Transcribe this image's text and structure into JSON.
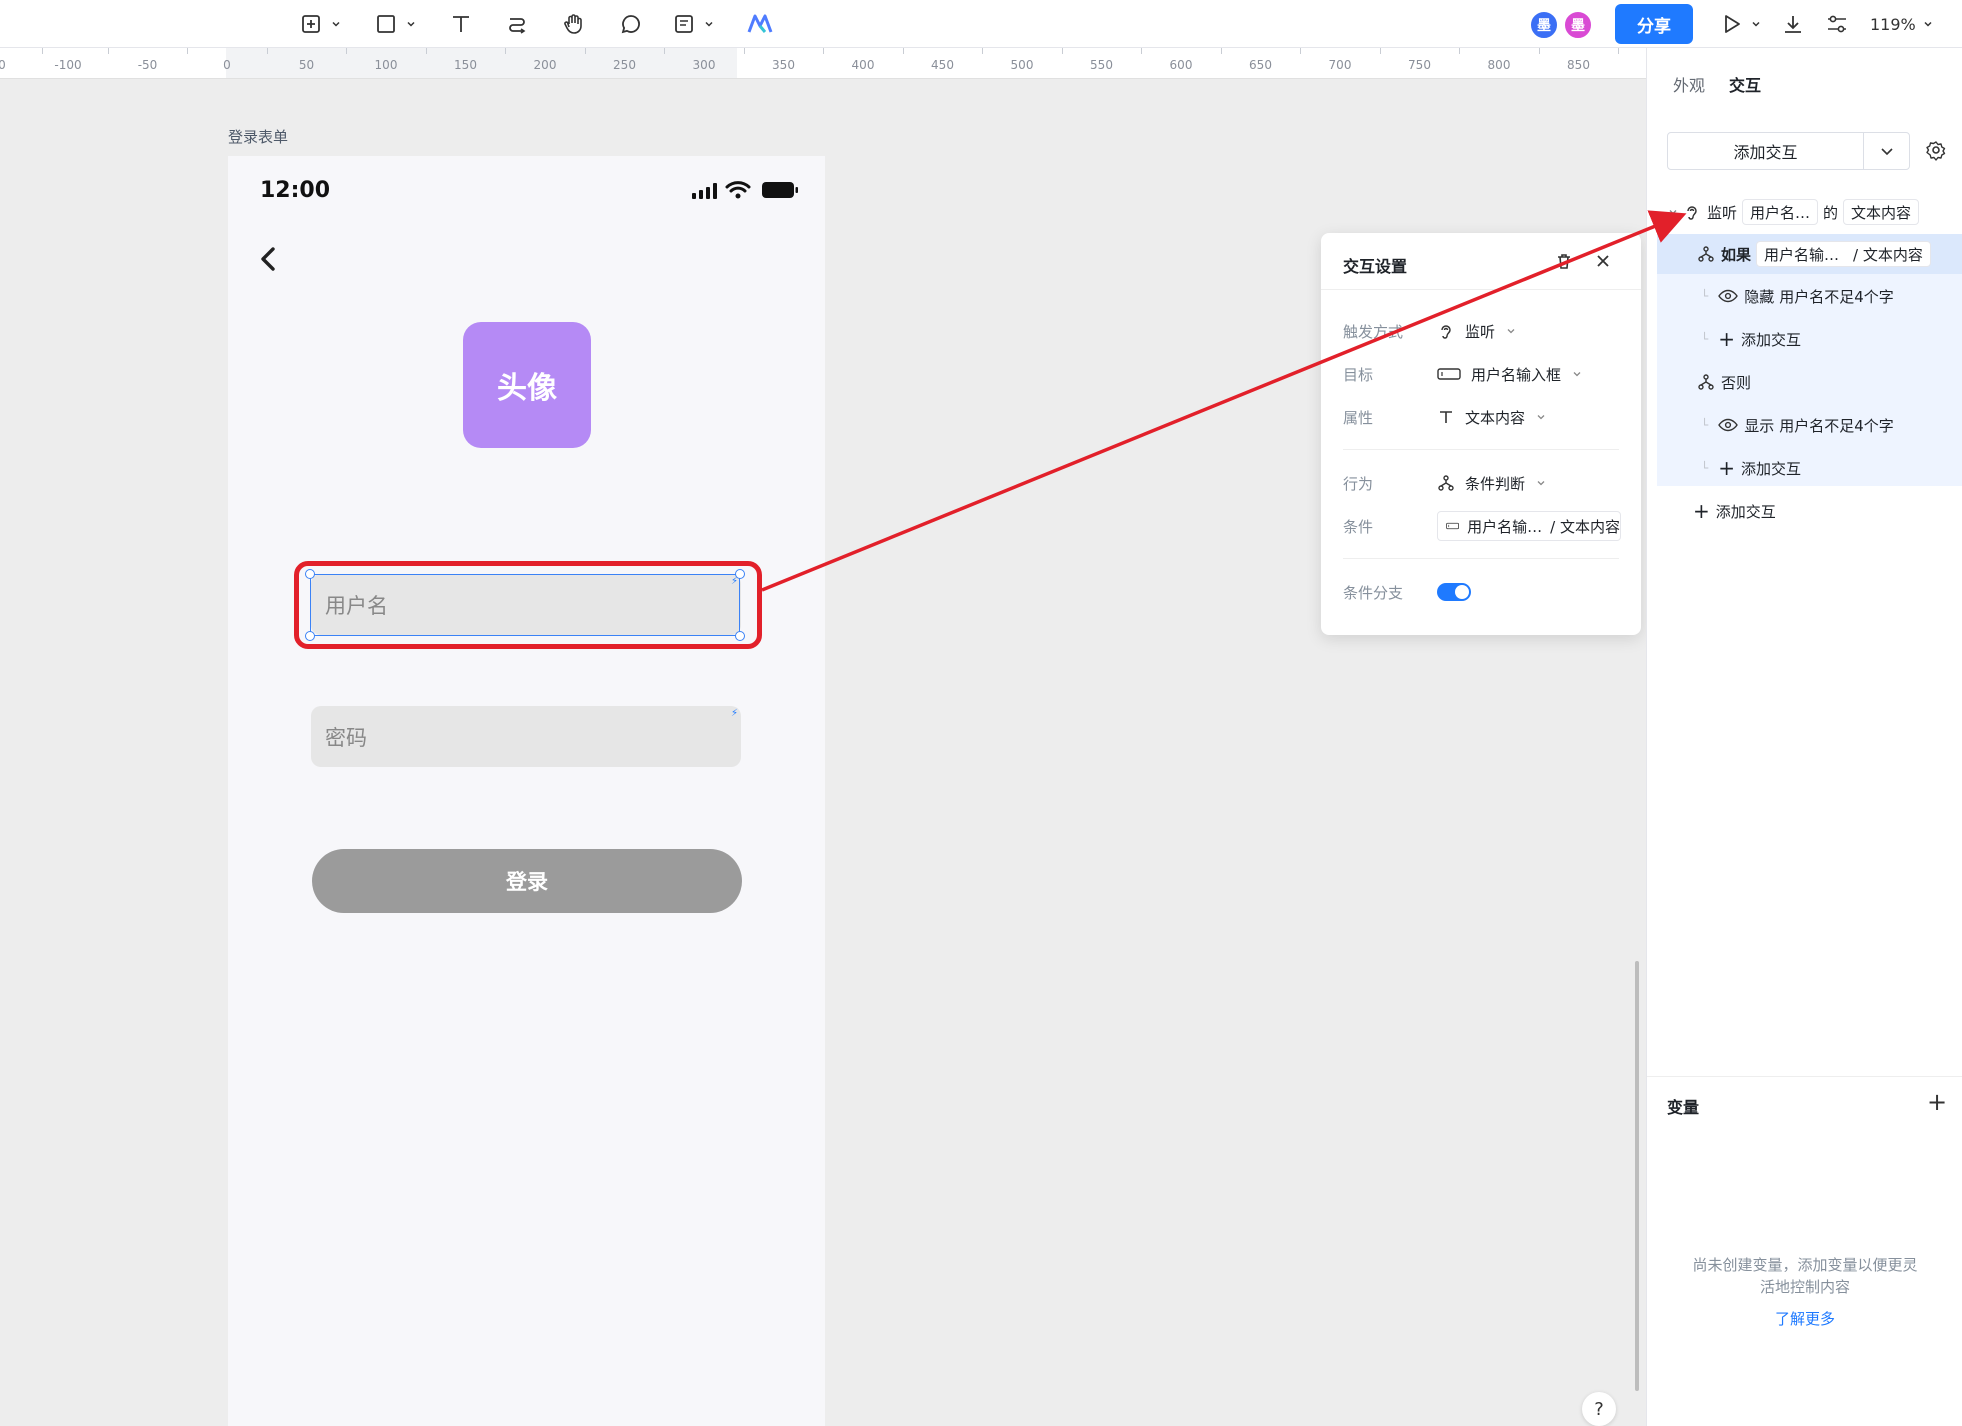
{
  "toolbar": {
    "tools": [
      {
        "name": "add-frame-tool",
        "icon": "frame-add-icon",
        "has_dropdown": true
      },
      {
        "name": "rectangle-tool",
        "icon": "rectangle-icon",
        "has_dropdown": true
      },
      {
        "name": "text-tool",
        "icon": "text-icon",
        "has_dropdown": false
      },
      {
        "name": "connector-tool",
        "icon": "connector-icon",
        "has_dropdown": false
      },
      {
        "name": "hand-tool",
        "icon": "hand-icon",
        "has_dropdown": false
      },
      {
        "name": "comment-tool",
        "icon": "comment-icon",
        "has_dropdown": false
      },
      {
        "name": "note-tool",
        "icon": "note-icon",
        "has_dropdown": true
      },
      {
        "name": "ai-tool",
        "icon": "ai-logo-icon",
        "has_dropdown": false
      }
    ],
    "collaborators": [
      {
        "initial": "墨",
        "color": "#3b6ff5"
      },
      {
        "initial": "墨",
        "color": "#d94ad4"
      }
    ],
    "share_label": "分享",
    "zoom": "119%"
  },
  "ruler": {
    "ticks": [
      "0",
      "-100",
      "-50",
      "0",
      "50",
      "100",
      "150",
      "200",
      "250",
      "300",
      "350",
      "400",
      "450",
      "500",
      "550",
      "600",
      "650",
      "700",
      "750",
      "800",
      "850"
    ]
  },
  "canvas": {
    "frame_label": "登录表单",
    "phone": {
      "time": "12:00",
      "avatar_text": "头像",
      "username_placeholder": "用户名",
      "password_placeholder": "密码",
      "login_label": "登录"
    },
    "help": "?"
  },
  "popup": {
    "title": "交互设置",
    "rows": {
      "trigger": {
        "label": "触发方式",
        "value": "监听"
      },
      "target": {
        "label": "目标",
        "value": "用户名输入框"
      },
      "property": {
        "label": "属性",
        "value": "文本内容"
      },
      "action": {
        "label": "行为",
        "value": "条件判断"
      },
      "condition": {
        "label": "条件",
        "value_a": "用户名输…",
        "value_b": "/ 文本内容"
      },
      "branch": {
        "label": "条件分支",
        "enabled": true
      }
    }
  },
  "panel": {
    "tabs": [
      "外观",
      "交互"
    ],
    "active_tab": "交互",
    "add_interaction": "添加交互",
    "tree": {
      "listen": {
        "keyword": "监听",
        "target": "用户名…",
        "of": "的",
        "property": "文本内容"
      },
      "if": {
        "keyword": "如果",
        "target": "用户名输…",
        "property": "/ 文本内容"
      },
      "if_action": {
        "verb": "隐藏",
        "target": "用户名不足4个字"
      },
      "if_add": "添加交互",
      "else": "否则",
      "else_action": {
        "verb": "显示",
        "target": "用户名不足4个字"
      },
      "else_add": "添加交互",
      "root_add": "添加交互"
    },
    "variables": {
      "title": "变量",
      "empty_text": "尚未创建变量，添加变量以便更灵活地控制内容",
      "learn_more": "了解更多"
    }
  },
  "colors": {
    "accent": "#1f7aff",
    "avatar_bg": "#b58af5",
    "highlight_red": "#e2202a"
  }
}
